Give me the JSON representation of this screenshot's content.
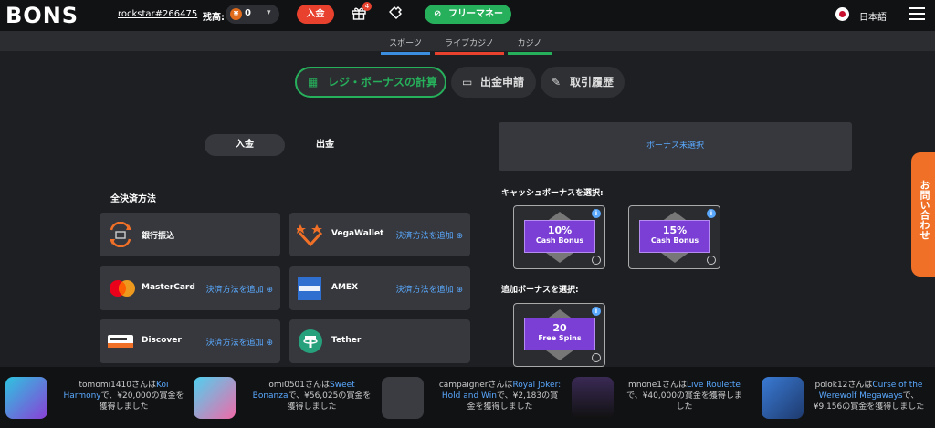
{
  "header": {
    "logo": "BONS",
    "username": "rockstar#266475",
    "balance_label": "残高:",
    "balance_value": "0",
    "coin_symbol": "¥",
    "deposit_label": "入金",
    "gift_badge": "4",
    "free_money_label": "フリーマネー",
    "language": "日本語"
  },
  "subnav": {
    "tabs": [
      {
        "label": "スポーツ",
        "color": "#3b8de0"
      },
      {
        "label": "ライブカジノ",
        "color": "#e8412e"
      },
      {
        "label": "カジノ",
        "color": "#27b05b"
      }
    ]
  },
  "main_tabs": {
    "calc": "レジ・ボーナスの計算",
    "withdraw": "出金申請",
    "history": "取引履歴"
  },
  "toggle": {
    "deposit": "入金",
    "withdraw": "出金"
  },
  "payment": {
    "section_title": "全決済方法",
    "add_label": "決済方法を追加 ⊕",
    "methods": [
      {
        "name": "銀行振込"
      },
      {
        "name": "VegaWallet"
      },
      {
        "name": "MasterCard"
      },
      {
        "name": "AMEX"
      },
      {
        "name": "Discover"
      },
      {
        "name": "Tether"
      }
    ]
  },
  "bonus": {
    "none_selected": "ボーナス未選択",
    "cash_label": "キャッシュボーナスを選択:",
    "extra_label": "追加ボーナスを選択:",
    "cards": [
      {
        "big": "10%",
        "small": "Cash Bonus"
      },
      {
        "big": "15%",
        "small": "Cash Bonus"
      },
      {
        "big": "20",
        "small": "Free Spins"
      }
    ]
  },
  "contact_label": "お問い合わせ",
  "ticker": [
    {
      "user": "tomomi1410さんは",
      "game": "Koi Harmony",
      "rest": "で、¥20,000の賞金を獲得しました"
    },
    {
      "user": "omi0501さんは",
      "game": "Sweet Bonanza",
      "rest": "で、¥56,025の賞金を獲得しました"
    },
    {
      "user": "campaignerさんは",
      "game": "Royal Joker: Hold and Win",
      "rest": "で、¥2,183の賞金を獲得しました"
    },
    {
      "user": "mnone1さんは",
      "game": "Live Roulette",
      "rest": "で、¥40,000の賞金を獲得しました"
    },
    {
      "user": "polok12さんは",
      "game": "Curse of the Werewolf Megaways",
      "rest": "で、¥9,156の賞金を獲得しました"
    }
  ]
}
